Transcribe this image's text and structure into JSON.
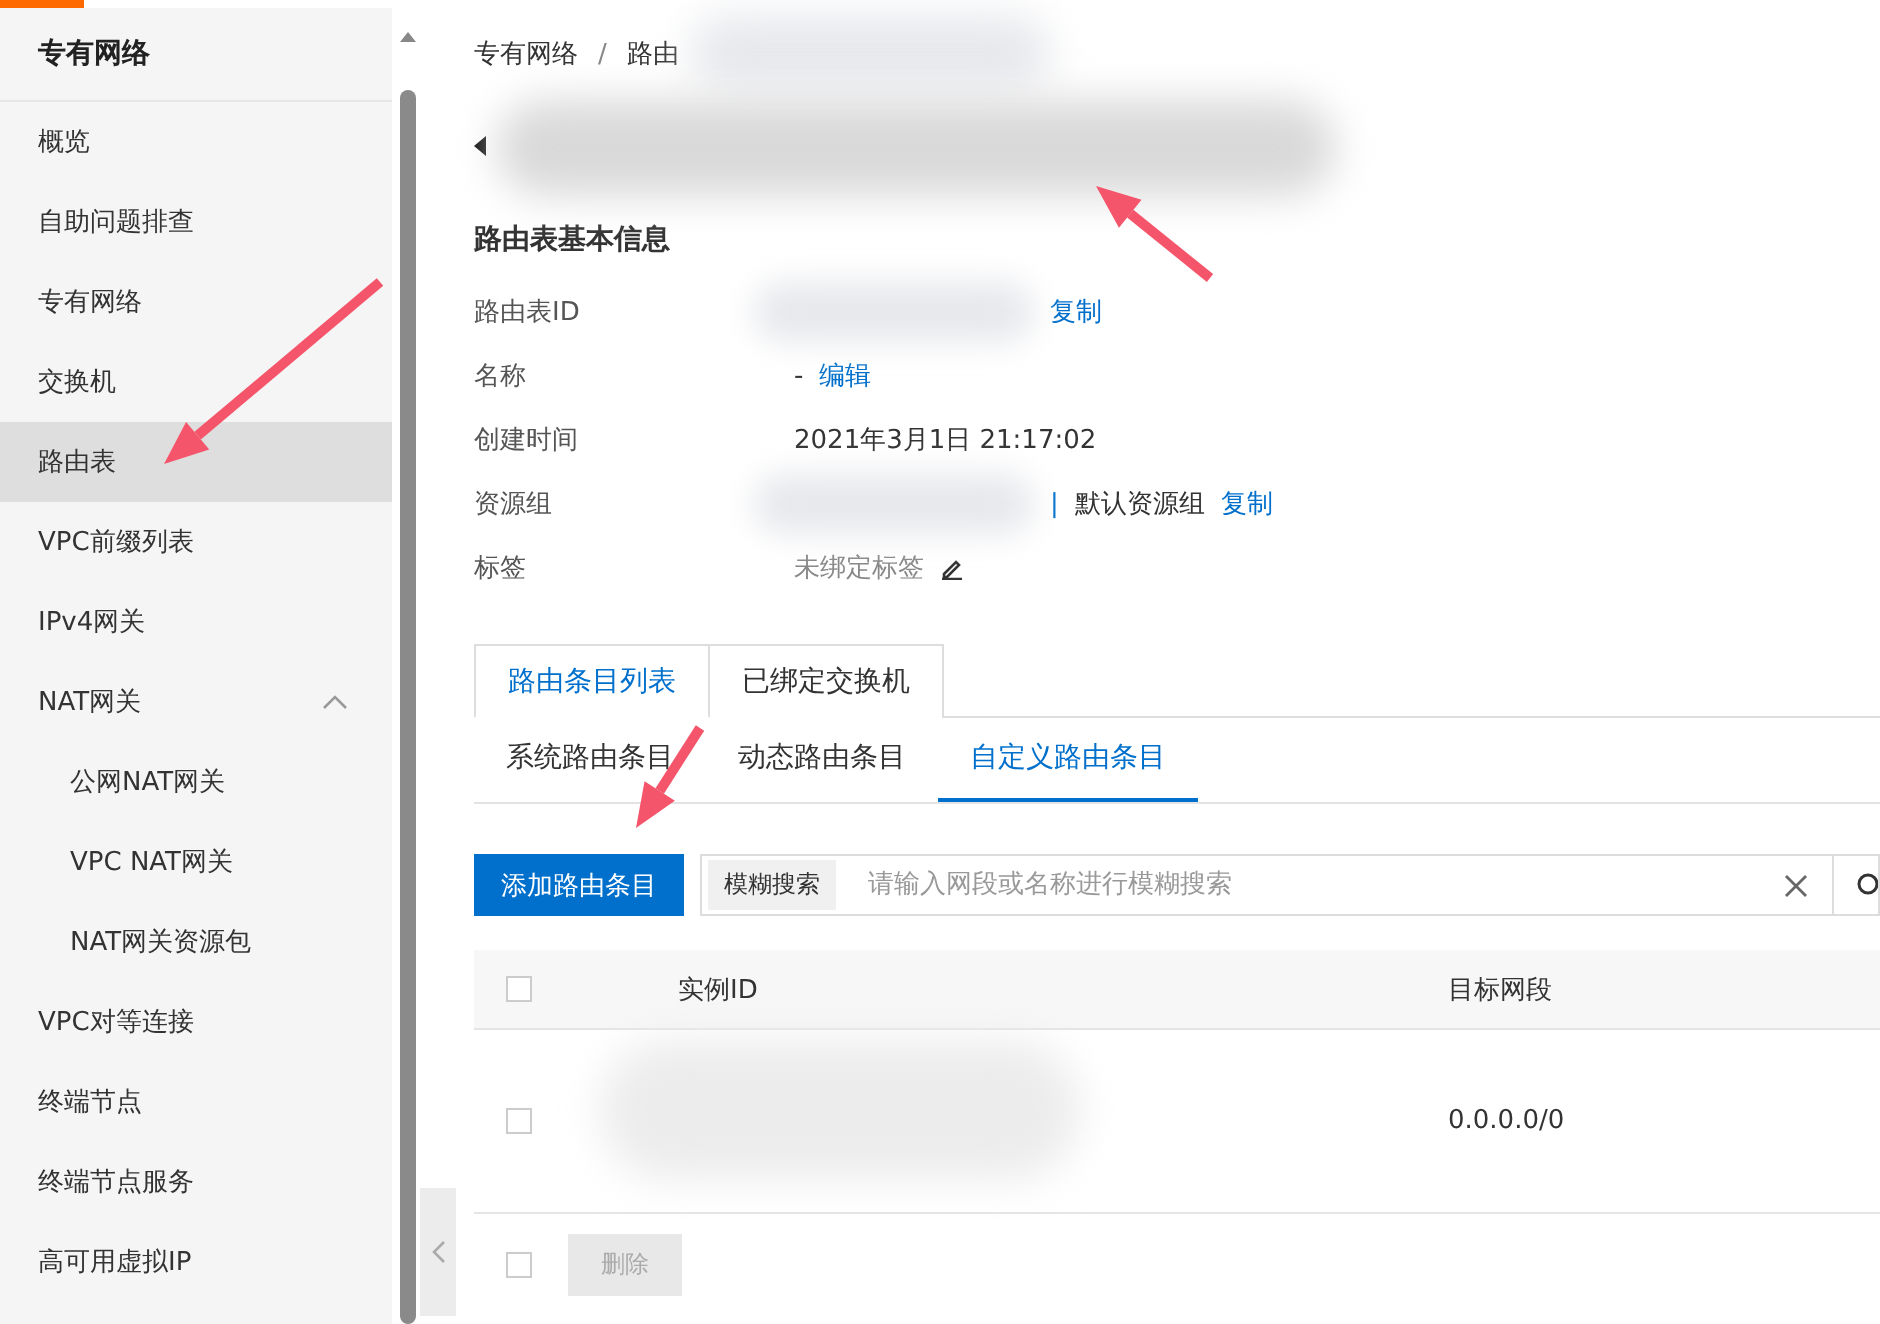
{
  "sidebar": {
    "title": "专有网络",
    "items": [
      {
        "label": "概览",
        "selected": false
      },
      {
        "label": "自助问题排查",
        "selected": false
      },
      {
        "label": "专有网络",
        "selected": false
      },
      {
        "label": "交换机",
        "selected": false
      },
      {
        "label": "路由表",
        "selected": true
      },
      {
        "label": "VPC前缀列表",
        "selected": false
      },
      {
        "label": "IPv4网关",
        "selected": false
      },
      {
        "label": "NAT网关",
        "selected": false,
        "expanded": true,
        "children": [
          {
            "label": "公网NAT网关",
            "selected": false
          },
          {
            "label": "VPC NAT网关",
            "selected": false
          },
          {
            "label": "NAT网关资源包",
            "selected": false
          }
        ]
      },
      {
        "label": "VPC对等连接",
        "selected": false
      },
      {
        "label": "终端节点",
        "selected": false
      },
      {
        "label": "终端节点服务",
        "selected": false
      },
      {
        "label": "高可用虚拟IP",
        "selected": false
      }
    ]
  },
  "breadcrumb": {
    "items": [
      "专有网络",
      "路由"
    ],
    "separator": "/"
  },
  "section_title": "路由表基本信息",
  "info": [
    {
      "label": "路由表ID",
      "parts": [
        {
          "kind": "redacted"
        },
        {
          "kind": "link",
          "text": "复制"
        }
      ]
    },
    {
      "label": "名称",
      "parts": [
        {
          "kind": "text",
          "text": "-"
        },
        {
          "kind": "link",
          "text": "编辑"
        }
      ]
    },
    {
      "label": "创建时间",
      "parts": [
        {
          "kind": "text",
          "text": "2021年3月1日 21:17:02"
        }
      ]
    },
    {
      "label": "资源组",
      "parts": [
        {
          "kind": "redacted"
        },
        {
          "kind": "sep",
          "text": "|"
        },
        {
          "kind": "text",
          "text": "默认资源组"
        },
        {
          "kind": "link",
          "text": "复制"
        }
      ]
    },
    {
      "label": "标签",
      "parts": [
        {
          "kind": "muted",
          "text": "未绑定标签"
        },
        {
          "kind": "edit"
        }
      ]
    }
  ],
  "tabs": [
    {
      "label": "路由条目列表",
      "selected": true
    },
    {
      "label": "已绑定交换机",
      "selected": false
    }
  ],
  "subtabs": [
    {
      "label": "系统路由条目",
      "selected": false
    },
    {
      "label": "动态路由条目",
      "selected": false
    },
    {
      "label": "自定义路由条目",
      "selected": true
    }
  ],
  "add_button": "添加路由条目",
  "search": {
    "mode": "模糊搜索",
    "placeholder": "请输入网段或名称进行模糊搜索"
  },
  "table": {
    "columns": [
      "实例ID",
      "目标网段"
    ],
    "rows": [
      {
        "checked": false,
        "target": "0.0.0.0/0"
      }
    ],
    "header_checked": false
  },
  "footer": {
    "checked": false,
    "delete_button": "删除",
    "delete_disabled": true
  }
}
